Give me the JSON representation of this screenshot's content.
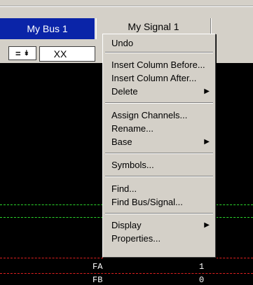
{
  "tabs": {
    "bus_label": "My Bus 1",
    "signal_label": "My Signal 1"
  },
  "controls": {
    "operator": "=",
    "value": "XX"
  },
  "waveform": {
    "rows": [
      {
        "label": "FA",
        "value": "1"
      },
      {
        "label": "FB",
        "value": "0"
      }
    ]
  },
  "context_menu": {
    "undo": "Undo",
    "insert_before": "Insert Column Before...",
    "insert_after": "Insert Column After...",
    "delete": "Delete",
    "assign_channels": "Assign Channels...",
    "rename": "Rename...",
    "base": "Base",
    "symbols": "Symbols...",
    "find": "Find...",
    "find_bus_signal": "Find Bus/Signal...",
    "display": "Display",
    "properties": "Properties..."
  },
  "colors": {
    "selected_tab": "#0a24a8",
    "trace_green": "#2bd62b",
    "trace_red": "#e02020"
  }
}
